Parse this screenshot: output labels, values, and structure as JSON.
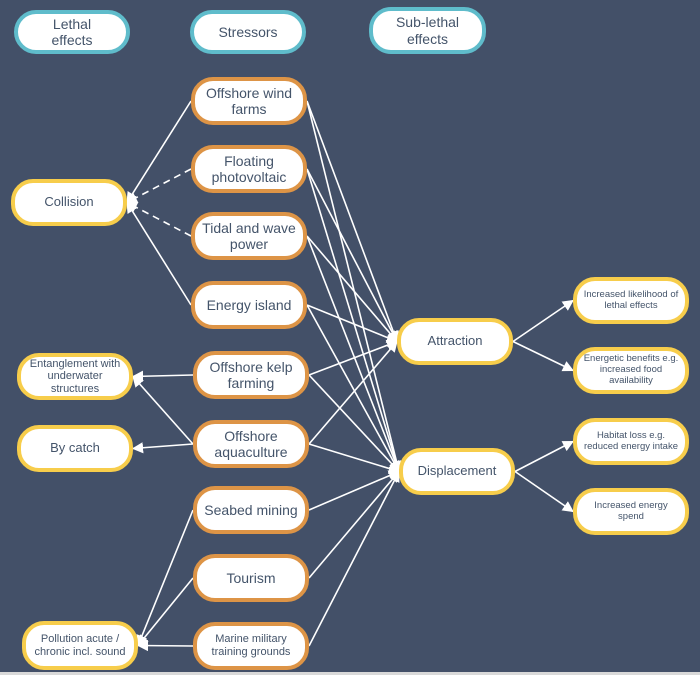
{
  "headers": {
    "lethal": "Lethal\neffects",
    "stressors": "Stressors",
    "sublethal": "Sub-lethal\neffects"
  },
  "stressors": [
    {
      "id": "wind",
      "label": "Offshore wind farms"
    },
    {
      "id": "floating",
      "label": "Floating photovoltaic"
    },
    {
      "id": "tidal",
      "label": "Tidal and wave power"
    },
    {
      "id": "island",
      "label": "Energy island"
    },
    {
      "id": "kelp",
      "label": "Offshore kelp farming"
    },
    {
      "id": "aquaculture",
      "label": "Offshore aquaculture"
    },
    {
      "id": "mining",
      "label": "Seabed mining"
    },
    {
      "id": "tourism",
      "label": "Tourism"
    },
    {
      "id": "military",
      "label": "Marine military training grounds"
    }
  ],
  "lethal_effects": [
    {
      "id": "collision",
      "label": "Collision"
    },
    {
      "id": "entanglement",
      "label": "Entanglement with underwater structures"
    },
    {
      "id": "bycatch",
      "label": "By catch"
    },
    {
      "id": "pollution",
      "label": "Pollution acute / chronic incl. sound"
    }
  ],
  "responses": [
    {
      "id": "attraction",
      "label": "Attraction"
    },
    {
      "id": "displacement",
      "label": "Displacement"
    }
  ],
  "sublethal_effects": [
    {
      "id": "likelihood",
      "label": "Increased likelihood of lethal effects"
    },
    {
      "id": "benefits",
      "label": "Energetic benefits e.g. increased food availability"
    },
    {
      "id": "habitat",
      "label": "Habitat loss e.g. reduced energy intake"
    },
    {
      "id": "spend",
      "label": "Increased energy spend"
    }
  ],
  "edges": [
    {
      "from": "wind",
      "to": "collision",
      "style": "solid"
    },
    {
      "from": "floating",
      "to": "collision",
      "style": "dashed"
    },
    {
      "from": "tidal",
      "to": "collision",
      "style": "dashed"
    },
    {
      "from": "island",
      "to": "collision",
      "style": "solid"
    },
    {
      "from": "kelp",
      "to": "entanglement",
      "style": "solid"
    },
    {
      "from": "aquaculture",
      "to": "entanglement",
      "style": "solid"
    },
    {
      "from": "aquaculture",
      "to": "bycatch",
      "style": "solid"
    },
    {
      "from": "mining",
      "to": "pollution",
      "style": "solid"
    },
    {
      "from": "tourism",
      "to": "pollution",
      "style": "solid"
    },
    {
      "from": "military",
      "to": "pollution",
      "style": "solid"
    },
    {
      "from": "wind",
      "to": "attraction",
      "style": "solid"
    },
    {
      "from": "floating",
      "to": "attraction",
      "style": "solid"
    },
    {
      "from": "tidal",
      "to": "attraction",
      "style": "solid"
    },
    {
      "from": "island",
      "to": "attraction",
      "style": "solid"
    },
    {
      "from": "kelp",
      "to": "attraction",
      "style": "solid"
    },
    {
      "from": "aquaculture",
      "to": "attraction",
      "style": "solid"
    },
    {
      "from": "wind",
      "to": "displacement",
      "style": "solid"
    },
    {
      "from": "floating",
      "to": "displacement",
      "style": "solid"
    },
    {
      "from": "tidal",
      "to": "displacement",
      "style": "solid"
    },
    {
      "from": "island",
      "to": "displacement",
      "style": "solid"
    },
    {
      "from": "kelp",
      "to": "displacement",
      "style": "solid"
    },
    {
      "from": "aquaculture",
      "to": "displacement",
      "style": "solid"
    },
    {
      "from": "mining",
      "to": "displacement",
      "style": "solid"
    },
    {
      "from": "tourism",
      "to": "displacement",
      "style": "solid"
    },
    {
      "from": "military",
      "to": "displacement",
      "style": "solid"
    },
    {
      "from": "attraction",
      "to": "likelihood",
      "style": "solid"
    },
    {
      "from": "attraction",
      "to": "benefits",
      "style": "solid"
    },
    {
      "from": "displacement",
      "to": "habitat",
      "style": "solid"
    },
    {
      "from": "displacement",
      "to": "spend",
      "style": "solid"
    }
  ],
  "colors": {
    "background": "#435068",
    "header_border": "#5fbccb",
    "stressor_border": "#dd9446",
    "effect_border": "#f7cd4b",
    "text": "#44546a",
    "edge": "#ffffff"
  }
}
